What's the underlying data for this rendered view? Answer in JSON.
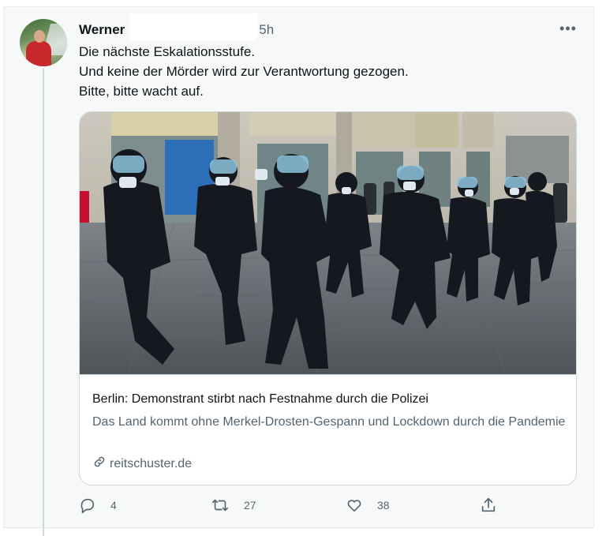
{
  "tweet": {
    "author_name": "Werner",
    "time": "5h",
    "more_icon": "more-horizontal-icon",
    "lines": [
      "Die nächste Eskalationsstufe.",
      "Und keine der Mörder wird zur Verantwortung gezogen.",
      "Bitte, bitte wacht auf."
    ]
  },
  "card": {
    "title": "Berlin: Demonstrant stirbt nach Festnahme durch die Polizei",
    "description": "Das Land kommt ohne Merkel-Drosten-Gespann und Lockdown durch die Pandemie",
    "domain": "reitschuster.de",
    "domain_icon": "link-icon"
  },
  "actions": {
    "reply_count": "4",
    "retweet_count": "27",
    "like_count": "38",
    "reply_icon": "reply-icon",
    "retweet_icon": "retweet-icon",
    "like_icon": "heart-icon",
    "share_icon": "share-icon"
  },
  "colors": {
    "text": "#0f1419",
    "secondary": "#536471",
    "border": "#cfd9de",
    "background": "#f7f9f9"
  }
}
